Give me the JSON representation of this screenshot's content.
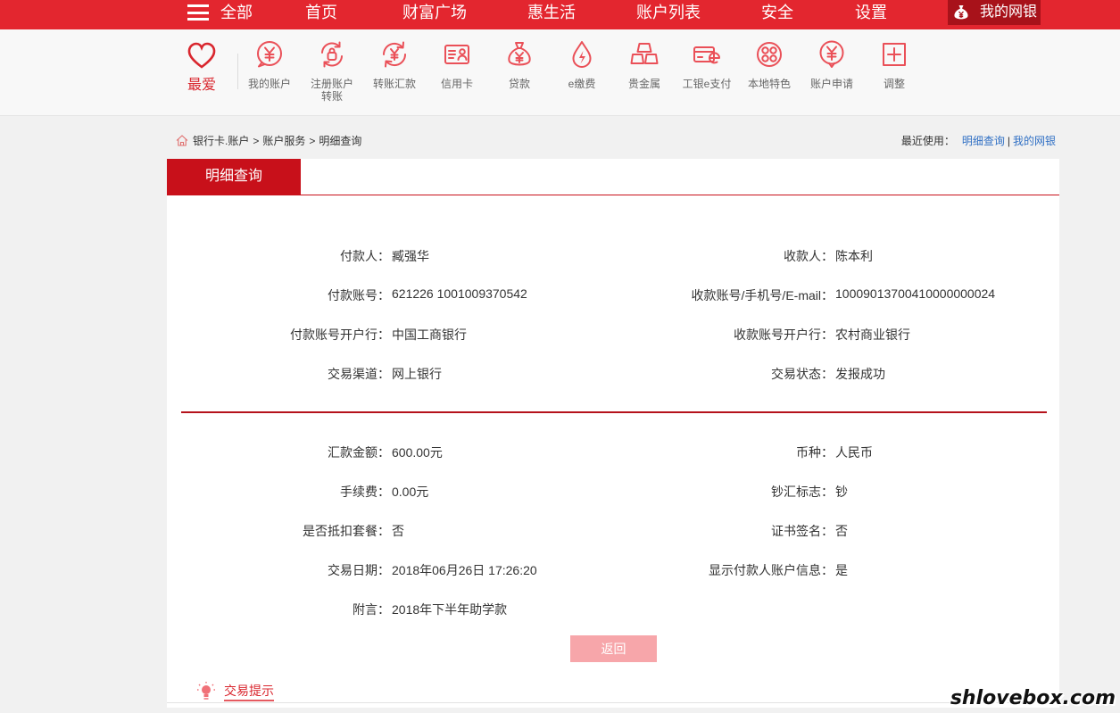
{
  "colors": {
    "brand_red": "#e3262f",
    "active_tab_dark": "#a8121a",
    "panel_tab_red": "#c8101a",
    "icon_red": "#ea5058",
    "link_blue": "#2f6fc4",
    "button_pink": "#f7a6aa"
  },
  "top_nav": {
    "menu": {
      "label": "全部",
      "icon": "hamburger-icon"
    },
    "items": [
      {
        "label": "首页"
      },
      {
        "label": "财富广场"
      },
      {
        "label": "惠生活"
      },
      {
        "label": "账户列表"
      },
      {
        "label": "安全"
      },
      {
        "label": "设置"
      }
    ],
    "active": {
      "label": "我的网银",
      "icon": "money-bag-icon"
    }
  },
  "quick_bar": {
    "favorite": {
      "label": "最爱",
      "icon": "heart-icon"
    },
    "items": [
      {
        "label_lines": [
          "我的账户"
        ],
        "icon": "yuan-bubble-icon"
      },
      {
        "label_lines": [
          "注册账户",
          "转账"
        ],
        "icon": "register-transfer-icon"
      },
      {
        "label_lines": [
          "转账汇款"
        ],
        "icon": "transfer-icon"
      },
      {
        "label_lines": [
          "信用卡"
        ],
        "icon": "credit-card-icon"
      },
      {
        "label_lines": [
          "贷款"
        ],
        "icon": "money-bag-icon"
      },
      {
        "label_lines": [
          "e缴费"
        ],
        "icon": "water-drop-icon"
      },
      {
        "label_lines": [
          "贵金属"
        ],
        "icon": "gold-bars-icon"
      },
      {
        "label_lines": [
          "工银e支付"
        ],
        "icon": "e-pay-card-icon"
      },
      {
        "label_lines": [
          "本地特色"
        ],
        "icon": "local-feature-icon"
      },
      {
        "label_lines": [
          "账户申请"
        ],
        "icon": "yuan-bubble-icon"
      },
      {
        "label_lines": [
          "调整"
        ],
        "icon": "plus-square-icon"
      }
    ]
  },
  "breadcrumb": {
    "icon": "home-icon",
    "items": [
      "银行卡.账户",
      "账户服务",
      "明细查询"
    ],
    "separator": ">"
  },
  "recent": {
    "label": "最近使用：",
    "links": [
      "明细查询",
      "我的网银"
    ],
    "divider": "|"
  },
  "panel": {
    "tab": "明细查询",
    "parties": [
      {
        "left": {
          "label": "付款人：",
          "value": "臧强华"
        },
        "right": {
          "label": "收款人：",
          "value": "陈本利"
        }
      },
      {
        "left": {
          "label": "付款账号：",
          "value": "621226 1001009370542"
        },
        "right": {
          "label": "收款账号/手机号/E-mail：",
          "value": "10009013700410000000024"
        }
      },
      {
        "left": {
          "label": "付款账号开户行：",
          "value": "中国工商银行"
        },
        "right": {
          "label": "收款账号开户行：",
          "value": "农村商业银行"
        }
      },
      {
        "left": {
          "label": "交易渠道：",
          "value": "网上银行"
        },
        "right": {
          "label": "交易状态：",
          "value": "发报成功"
        }
      }
    ],
    "amounts": [
      {
        "left": {
          "label": "汇款金额：",
          "value": "600.00元"
        },
        "right": {
          "label": "币种：",
          "value": "人民币"
        }
      },
      {
        "left": {
          "label": "手续费：",
          "value": "0.00元"
        },
        "right": {
          "label": "钞汇标志：",
          "value": "钞"
        }
      },
      {
        "left": {
          "label": "是否抵扣套餐：",
          "value": "否"
        },
        "right": {
          "label": "证书签名：",
          "value": "否"
        }
      },
      {
        "left": {
          "label": "交易日期：",
          "value": "2018年06月26日 17:26:20"
        },
        "right": {
          "label": "显示付款人账户信息：",
          "value": "是"
        }
      },
      {
        "left": {
          "label": "附言：",
          "value": "2018年下半年助学款"
        }
      }
    ],
    "back_button": "返回",
    "tips": {
      "label": "交易提示",
      "icon": "lightbulb-icon"
    }
  },
  "watermark": "shlovebox.com"
}
